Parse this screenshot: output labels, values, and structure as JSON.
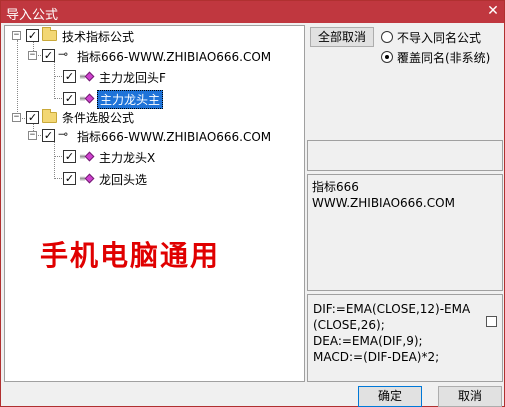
{
  "window": {
    "title": "导入公式",
    "close_glyph": "✕"
  },
  "tree": {
    "nodes": [
      {
        "label": "技术指标公式",
        "checked": true
      },
      {
        "label": "指标666-WWW.ZHIBIAO666.COM",
        "checked": true
      },
      {
        "label": "主力龙回头F",
        "checked": true
      },
      {
        "label": "主力龙头主",
        "checked": true,
        "selected": true
      },
      {
        "label": "条件选股公式",
        "checked": true
      },
      {
        "label": "指标666-WWW.ZHIBIAO666.COM",
        "checked": true
      },
      {
        "label": "主力龙头X",
        "checked": true
      },
      {
        "label": "龙回头选",
        "checked": true
      }
    ],
    "check_glyph": "✓",
    "collapse_glyph": "−",
    "key_glyph": "⊸"
  },
  "watermark": "手机电脑通用",
  "buttons": {
    "cancel_all": "全部取消",
    "ok": "确定",
    "cancel": "取消"
  },
  "options": {
    "no_import_same_name": "不导入同名公式",
    "overwrite_same_name": "覆盖同名(非系统)",
    "selected": "overwrite_same_name"
  },
  "info": {
    "text": "指标666\nWWW.ZHIBIAO666.COM"
  },
  "formula": {
    "text": "DIF:=EMA(CLOSE,12)-EMA\n(CLOSE,26);\nDEA:=EMA(DIF,9);\nMACD:=(DIF-DEA)*2;"
  },
  "colors": {
    "titlebar": "#c0373f",
    "selection": "#1e73d8",
    "watermark": "#e00000"
  }
}
